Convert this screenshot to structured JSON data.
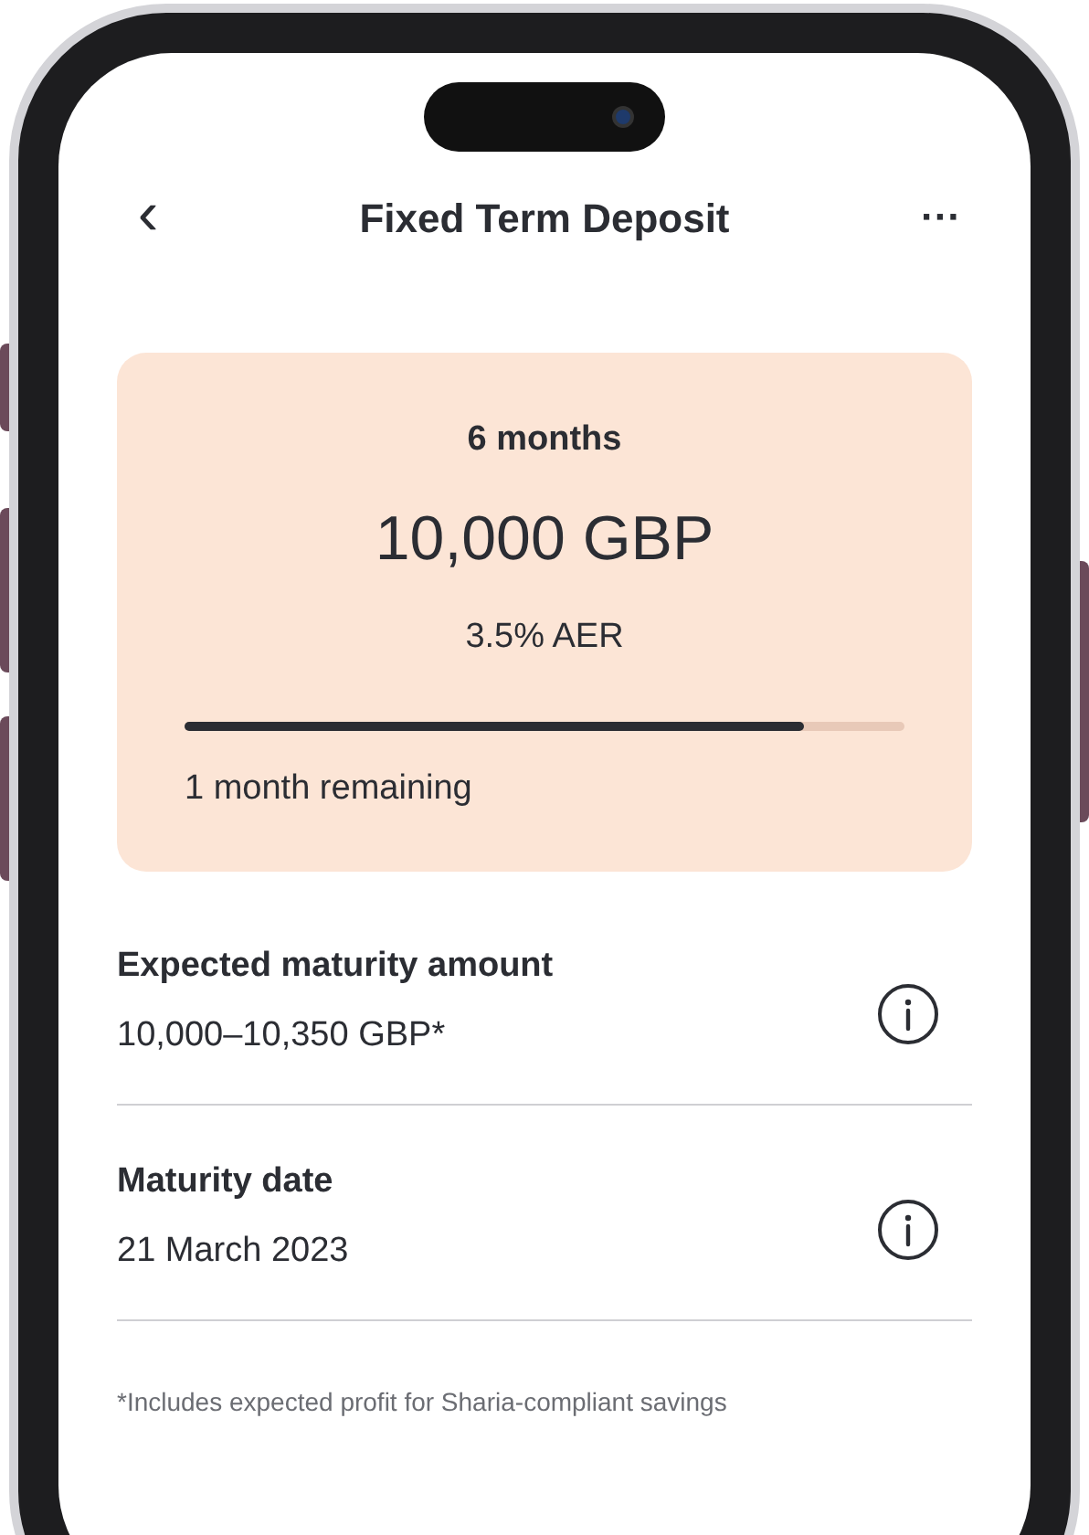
{
  "header": {
    "back": "‹",
    "title": "Fixed Term Deposit",
    "more": "···"
  },
  "deposit": {
    "term": "6 months",
    "amount": "10,000 GBP",
    "rate": "3.5% AER",
    "level": 0.86,
    "remaining": "1 month remaining"
  },
  "details": [
    {
      "label": "Expected maturity amount",
      "value": "10,000–10,350 GBP*"
    },
    {
      "label": "Maturity date",
      "value": "21 March 2023"
    }
  ],
  "footnote": "*Includes expected profit for Sharia-compliant savings"
}
